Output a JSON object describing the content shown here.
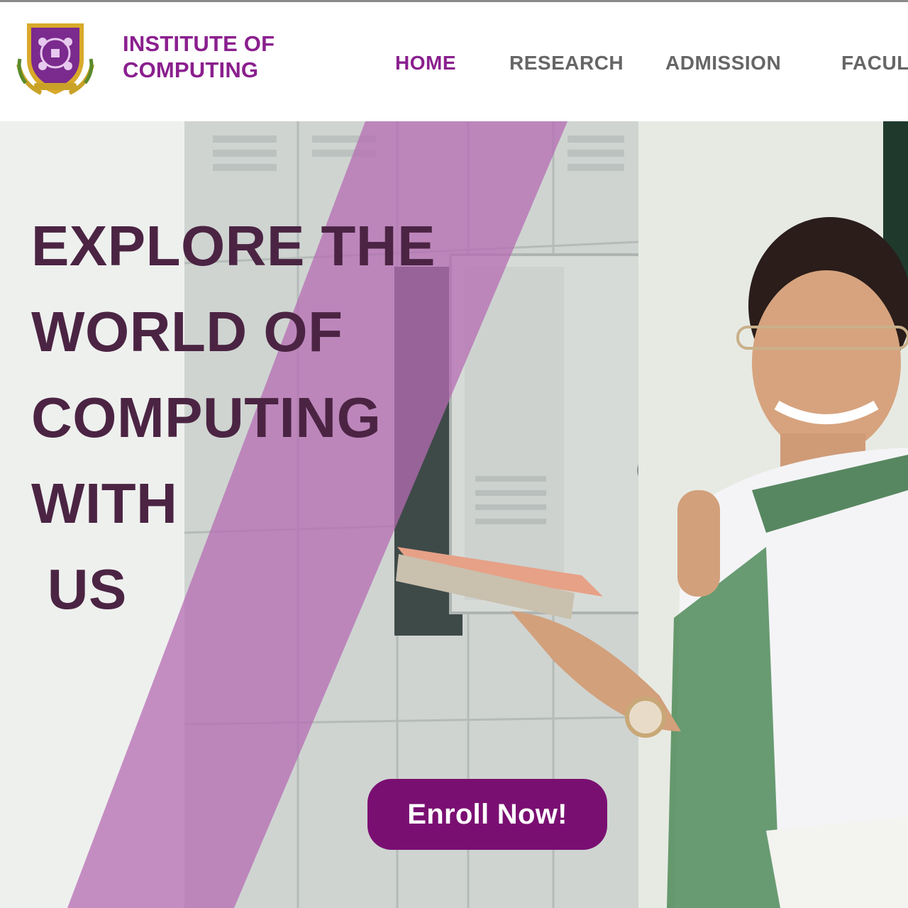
{
  "header": {
    "brand_line1": "INSTITUTE OF",
    "brand_line2": "COMPUTING",
    "logo_icon": "institute-crest-icon"
  },
  "nav": {
    "items": [
      {
        "label": "HOME",
        "active": true
      },
      {
        "label": "RESEARCH",
        "active": false
      },
      {
        "label": "ADMISSION",
        "active": false
      },
      {
        "label": "FACULT",
        "active": false
      }
    ]
  },
  "hero": {
    "headline": [
      "EXPLORE THE",
      "WORLD OF",
      "COMPUTING",
      "WITH",
      " US"
    ],
    "cta_label": "Enroll Now!"
  },
  "colors": {
    "brand": "#8a1f8e",
    "headline": "#4b2443",
    "cta": "#7a0f72",
    "overlay": "#b66cb3",
    "nav_inactive": "#666666"
  }
}
